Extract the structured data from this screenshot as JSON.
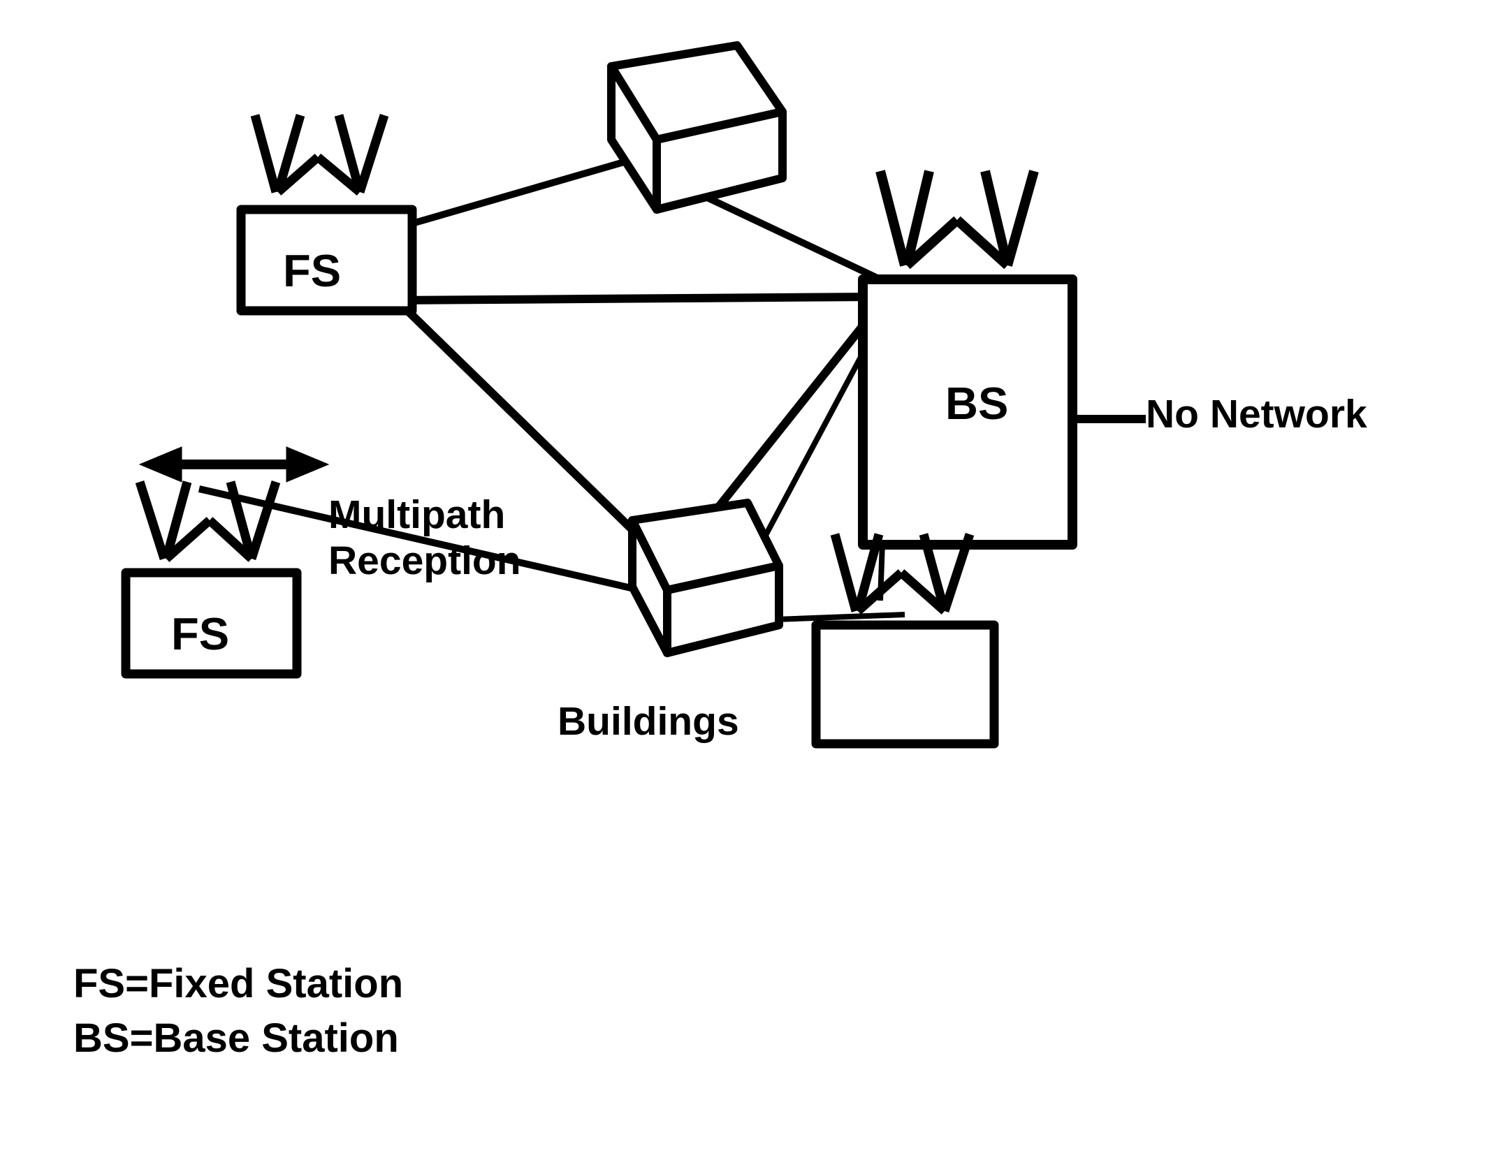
{
  "nodes": {
    "fs1": "FS",
    "fs2": "FS",
    "bs": "BS"
  },
  "labels": {
    "no_network": "No Network",
    "multipath_line1": "Multipath",
    "multipath_line2": "Reception",
    "buildings": "Buildings"
  },
  "legend": {
    "fs": "FS=Fixed Station",
    "bs": "BS=Base Station"
  }
}
